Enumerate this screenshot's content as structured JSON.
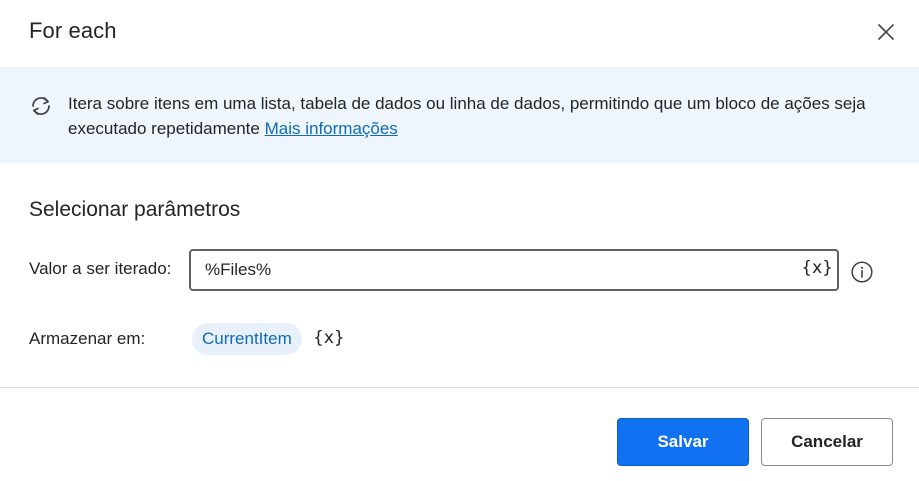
{
  "dialog": {
    "title": "For each",
    "close_icon": "close-icon"
  },
  "banner": {
    "icon": "loop-icon",
    "text": "Itera sobre itens em uma lista, tabela de dados ou linha de dados, permitindo que um bloco de ações seja executado repetidamente",
    "link_text": "Mais informações",
    "background": "#eff5fc",
    "link_color": "#0f6cbd"
  },
  "params": {
    "section_title": "Selecionar parâmetros",
    "iterate_label": "Valor a ser iterado:",
    "iterate_value": "%Files%",
    "var_icon_text": "{x}",
    "info_icon": "info-icon",
    "store_label": "Armazenar em:",
    "store_variable": "CurrentItem",
    "store_var_icon_text": "{x}"
  },
  "footer": {
    "save_label": "Salvar",
    "cancel_label": "Cancelar",
    "save_color": "#1072f0"
  }
}
